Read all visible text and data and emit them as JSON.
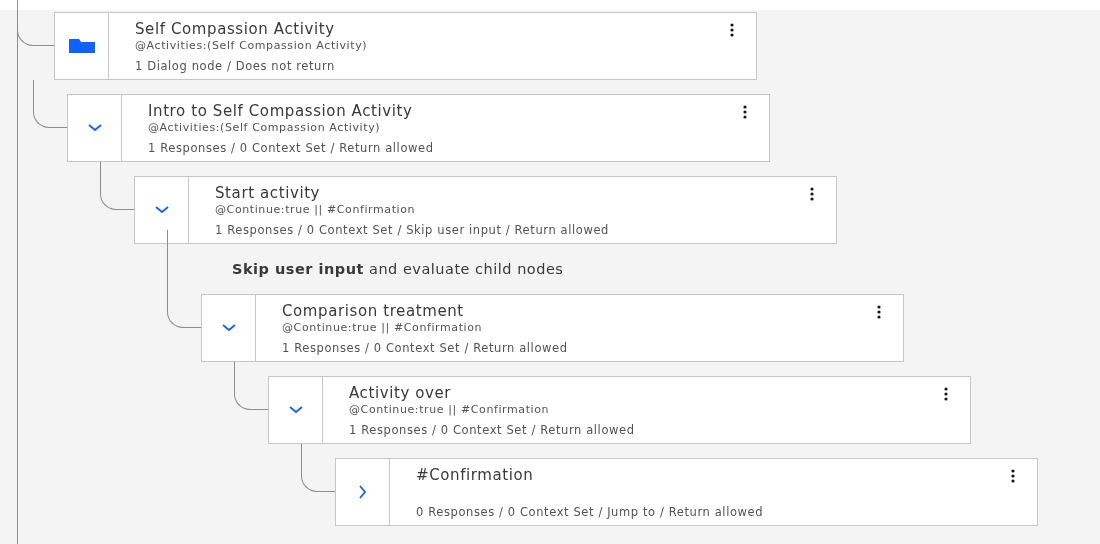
{
  "tree": [
    {
      "title": "Self Compassion Activity",
      "condition": "@Activities:(Self Compassion Activity)",
      "summary": "1 Dialog node / Does not return",
      "kind": "folder",
      "children": [
        {
          "title": "Intro to Self Compassion Activity",
          "condition": "@Activities:(Self Compassion Activity)",
          "summary": "1 Responses / 0 Context Set / Return allowed",
          "kind": "node",
          "expanded": true,
          "children": [
            {
              "title": "Start activity",
              "condition": "@Continue:true || #Confirmation",
              "summary": "1 Responses / 0 Context Set / Skip user input / Return allowed",
              "kind": "node",
              "expanded": true,
              "note": "**Skip user input** and evaluate child nodes",
              "children": [
                {
                  "title": "Comparison treatment",
                  "condition": "@Continue:true || #Confirmation",
                  "summary": "1 Responses / 0 Context Set / Return allowed",
                  "kind": "node",
                  "expanded": true,
                  "children": [
                    {
                      "title": "Activity over",
                      "condition": "@Continue:true || #Confirmation",
                      "summary": "1 Responses / 0 Context Set / Return allowed",
                      "kind": "node",
                      "expanded": true,
                      "children": [
                        {
                          "title": "#Confirmation",
                          "summary": "0 Responses / 0 Context Set / Jump to / Return allowed",
                          "kind": "node",
                          "expanded": false
                        }
                      ]
                    }
                  ]
                }
              ]
            }
          ]
        }
      ]
    }
  ]
}
